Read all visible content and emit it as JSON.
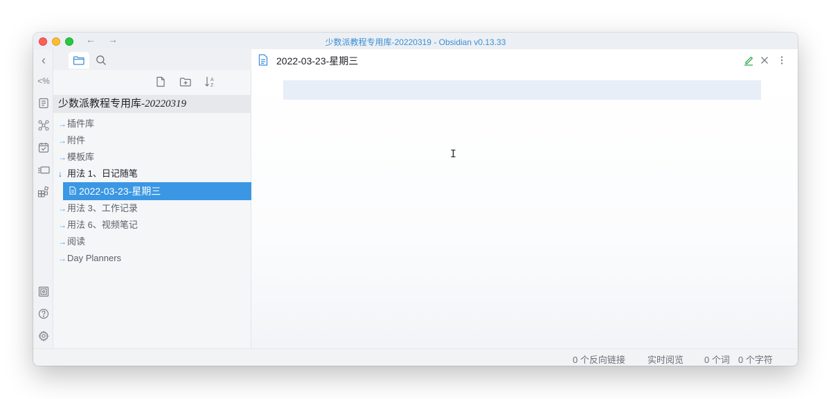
{
  "window": {
    "title": "少数派教程专用库-20220319 - Obsidian v0.13.33",
    "back_icon": "arrow-left-icon",
    "forward_icon": "arrow-right-icon"
  },
  "ribbon": {
    "collapse_glyph": "‹",
    "items": [
      {
        "name": "embed-code",
        "glyph": "<%"
      },
      {
        "name": "outline-icon",
        "glyph": "≡"
      },
      {
        "name": "graph-icon",
        "glyph": "⚬"
      },
      {
        "name": "calendar-icon",
        "glyph": "☑"
      },
      {
        "name": "cards-icon",
        "glyph": "▭"
      },
      {
        "name": "blocks-icon",
        "glyph": "▦"
      }
    ],
    "bottom": [
      {
        "name": "vault-icon",
        "glyph": "◙"
      },
      {
        "name": "help-icon",
        "glyph": "?"
      },
      {
        "name": "settings-icon",
        "glyph": "⚙"
      }
    ]
  },
  "sidebar": {
    "tabs": [
      {
        "name": "folder-icon",
        "active": true
      },
      {
        "name": "search-icon",
        "active": false
      }
    ],
    "actions": [
      {
        "name": "new-note-icon"
      },
      {
        "name": "new-folder-icon"
      },
      {
        "name": "sort-icon"
      }
    ],
    "vault_name": "少数派教程专用库",
    "vault_date": "-20220319",
    "folders_top": [
      {
        "label": "插件库"
      },
      {
        "label": "附件"
      },
      {
        "label": "模板库"
      }
    ],
    "open_folder": "用法 1、日记随笔",
    "selected_file": "2022-03-23-星期三",
    "folders_bottom": [
      {
        "label": "用法 3、工作记录"
      },
      {
        "label": "用法 6、视频笔记"
      },
      {
        "label": "阅读"
      },
      {
        "label": "Day Planners"
      }
    ],
    "collapsed_arrow": "→",
    "expanded_arrow": "↓"
  },
  "editor": {
    "tab_title": "2022-03-23-星期三",
    "ibeam": "I"
  },
  "status": {
    "backlinks": "0 个反向链接",
    "mode": "实时阅览",
    "words": "0 个词",
    "chars": "0 个字符"
  },
  "colors": {
    "accent": "#3b97e3",
    "title_blue": "#3a8fd6",
    "edit_green": "#2ea84a"
  }
}
